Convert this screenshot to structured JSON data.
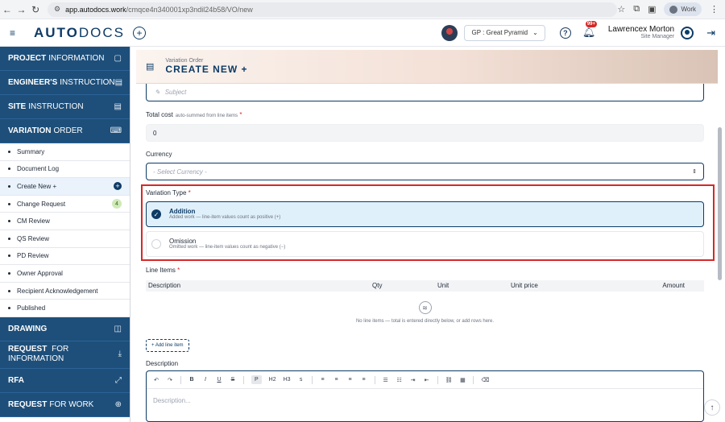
{
  "browser": {
    "url_host": "app.autodocs.work",
    "url_path": "/cmqce4n340001xp3ndil24b58/VO/new",
    "profile_label": "Work"
  },
  "header": {
    "brand_bold": "AUTO",
    "brand_light": "DOCS",
    "project_select": "GP : Great Pyramid",
    "notification_badge": "99+",
    "user_name": "Lawrencex Morton",
    "user_role": "Site Manager"
  },
  "sidebar": {
    "sections": [
      {
        "bold": "PROJECT",
        "rest": "INFORMATION"
      },
      {
        "bold": "ENGINEER'S",
        "rest": "INSTRUCTION"
      },
      {
        "bold": "SITE",
        "rest": "INSTRUCTION"
      },
      {
        "bold": "VARIATION",
        "rest": "ORDER"
      }
    ],
    "vo_items": [
      {
        "label": "Summary"
      },
      {
        "label": "Document Log"
      },
      {
        "label": "Create New +"
      },
      {
        "label": "Change Request",
        "count": "4"
      },
      {
        "label": "CM Review"
      },
      {
        "label": "QS Review"
      },
      {
        "label": "PD Review"
      },
      {
        "label": "Owner Approval"
      },
      {
        "label": "Recipient Acknowledgement"
      },
      {
        "label": "Published"
      }
    ],
    "lower_sections": [
      {
        "bold": "DRAWING",
        "rest": ""
      },
      {
        "bold": "REQUEST",
        "rest": "FOR",
        "line2": "INFORMATION"
      },
      {
        "bold": "RFA",
        "rest": ""
      },
      {
        "bold": "REQUEST",
        "rest": "FOR WORK"
      }
    ]
  },
  "form": {
    "kicker": "Variation Order",
    "title": "CREATE NEW +",
    "subject_placeholder": "Subject",
    "total_cost_label": "Total cost",
    "total_cost_hint": "auto-summed from line items",
    "total_cost_value": "0",
    "currency_label": "Currency",
    "currency_placeholder": "- Select Currency -",
    "variation_type_label": "Variation Type",
    "variation_types": [
      {
        "title": "Addition",
        "desc": "Added work — line-item values count as positive (+)",
        "selected": true
      },
      {
        "title": "Omission",
        "desc": "Omitted work — line-item values count as negative (−)",
        "selected": false
      }
    ],
    "line_items_label": "Line Items",
    "line_item_columns": [
      "Description",
      "Qty",
      "Unit",
      "Unit price",
      "Amount"
    ],
    "empty_message": "No line items — total is entered directly below, or add rows here.",
    "add_line_button": "+ Add line item",
    "description_label": "Description",
    "description_placeholder": "Description...",
    "required_mark": "*"
  },
  "toolbar_items": [
    "↶",
    "↷",
    "B",
    "I",
    "U",
    "S",
    "P",
    "H2",
    "H3",
    "s"
  ]
}
